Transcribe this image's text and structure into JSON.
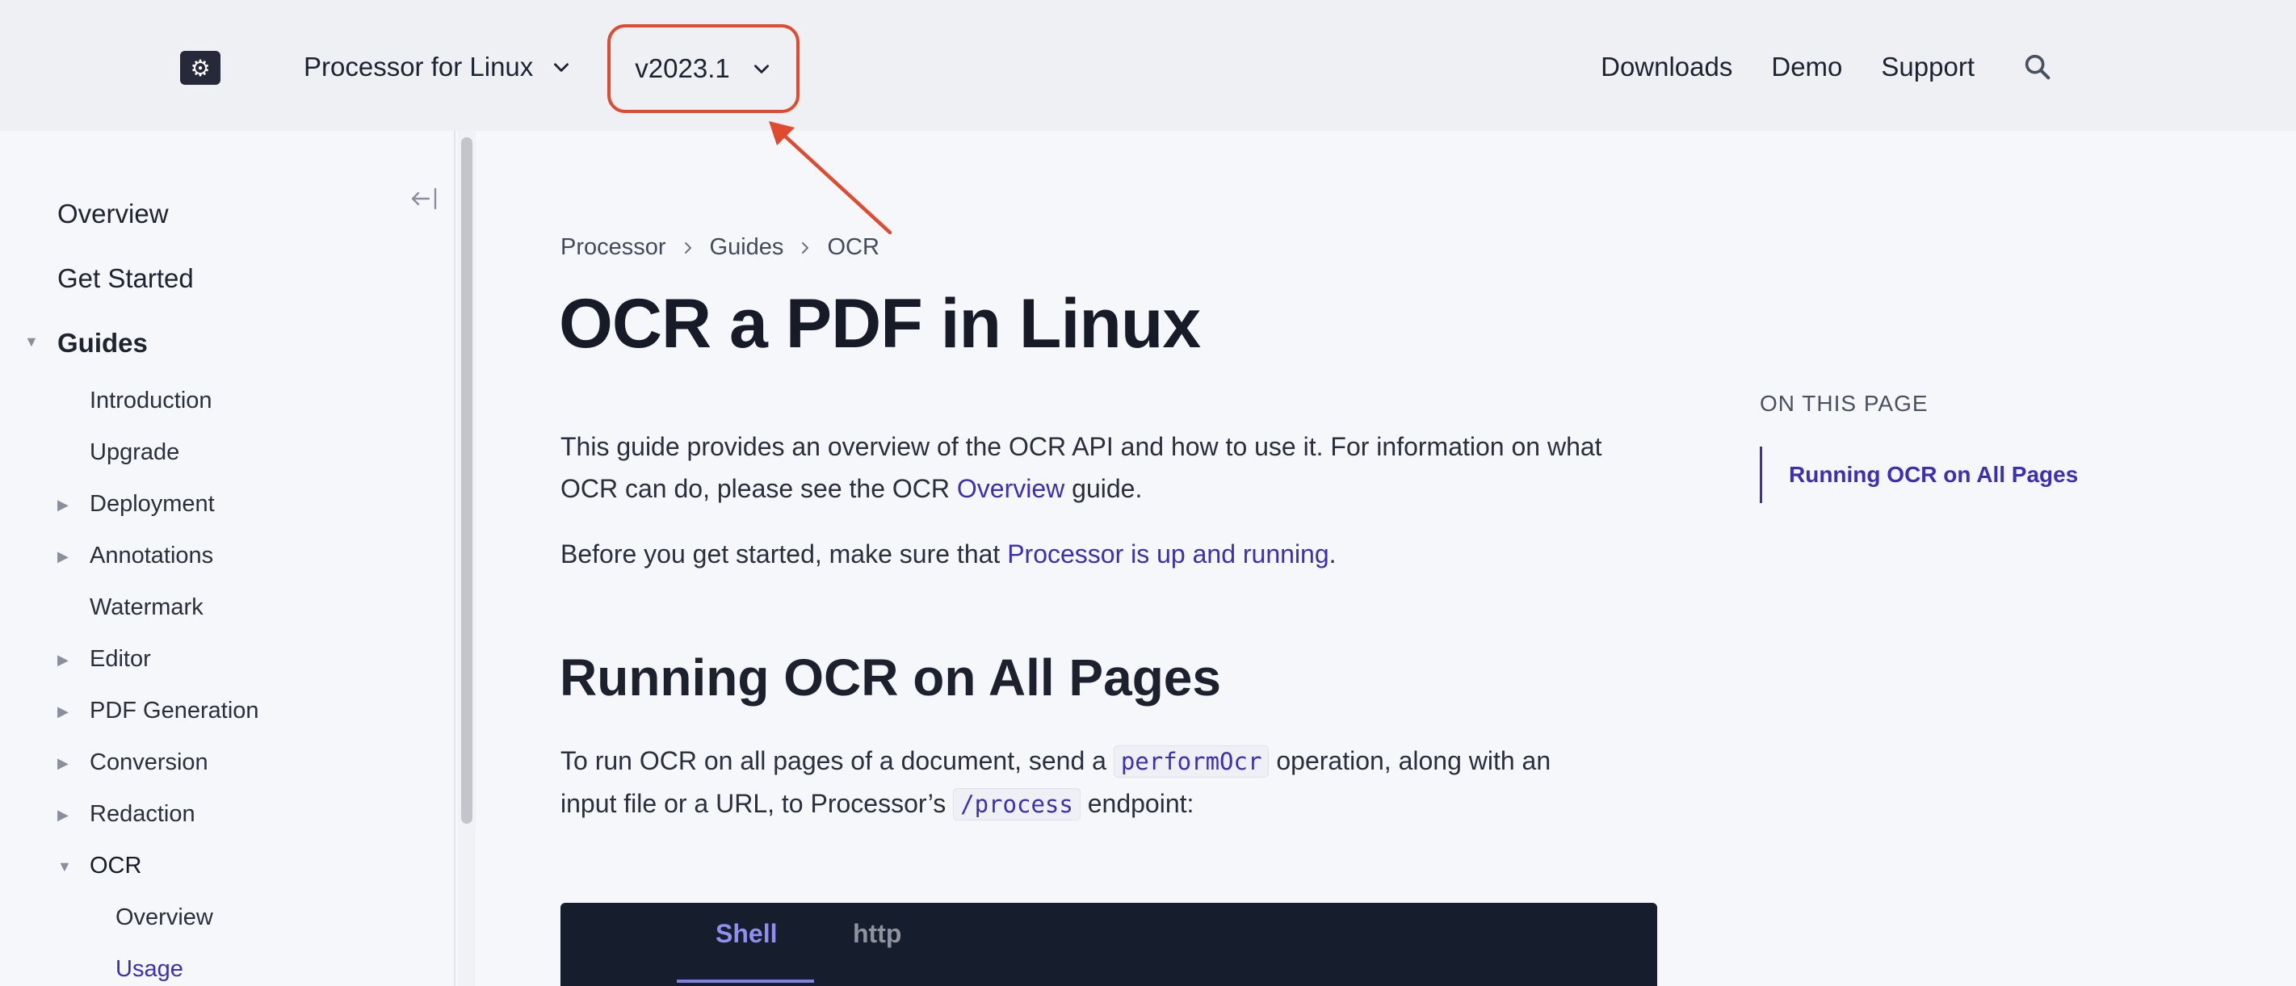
{
  "header": {
    "logo_icon": "gear-icon",
    "product": "Processor for Linux",
    "version": "v2023.1",
    "nav": [
      "Downloads",
      "Demo",
      "Support"
    ],
    "search_icon": "search-icon"
  },
  "sidebar": {
    "top_items": [
      "Overview",
      "Get Started",
      "Guides"
    ],
    "guides_items": [
      {
        "label": "Introduction",
        "expandable": false
      },
      {
        "label": "Upgrade",
        "expandable": false
      },
      {
        "label": "Deployment",
        "expandable": true
      },
      {
        "label": "Annotations",
        "expandable": true
      },
      {
        "label": "Watermark",
        "expandable": false
      },
      {
        "label": "Editor",
        "expandable": true
      },
      {
        "label": "PDF Generation",
        "expandable": true
      },
      {
        "label": "Conversion",
        "expandable": true
      },
      {
        "label": "Redaction",
        "expandable": true
      },
      {
        "label": "OCR",
        "expandable": true,
        "expanded": true
      }
    ],
    "ocr_items": [
      "Overview",
      "Usage"
    ],
    "active_item": "Usage"
  },
  "breadcrumb": [
    "Processor",
    "Guides",
    "OCR"
  ],
  "page": {
    "title": "OCR a PDF in Linux",
    "intro_1": "This guide provides an overview of the OCR API and how to use it. For information on what",
    "intro_2_pre": "OCR can do, please see the OCR ",
    "intro_2_link": "Overview",
    "intro_2_post": " guide.",
    "before_pre": "Before you get started, make sure that ",
    "before_link": "Processor is up and running",
    "before_post": ".",
    "section_title": "Running OCR on All Pages",
    "run_pre": "To run OCR on all pages of a document, send a ",
    "run_code1": "performOcr",
    "run_mid": " operation, along with an",
    "run_line2_pre": "input file or a URL, to Processor’s ",
    "run_code2": "/process",
    "run_line2_post": " endpoint:"
  },
  "code_tabs": [
    "Shell",
    "http"
  ],
  "active_code_tab": "Shell",
  "toc": {
    "title": "ON THIS PAGE",
    "links": [
      "Running OCR on All Pages"
    ]
  },
  "colors": {
    "accent": "#3d2fb3",
    "annotation": "#e04a2f",
    "code_bg": "#161d2c"
  }
}
